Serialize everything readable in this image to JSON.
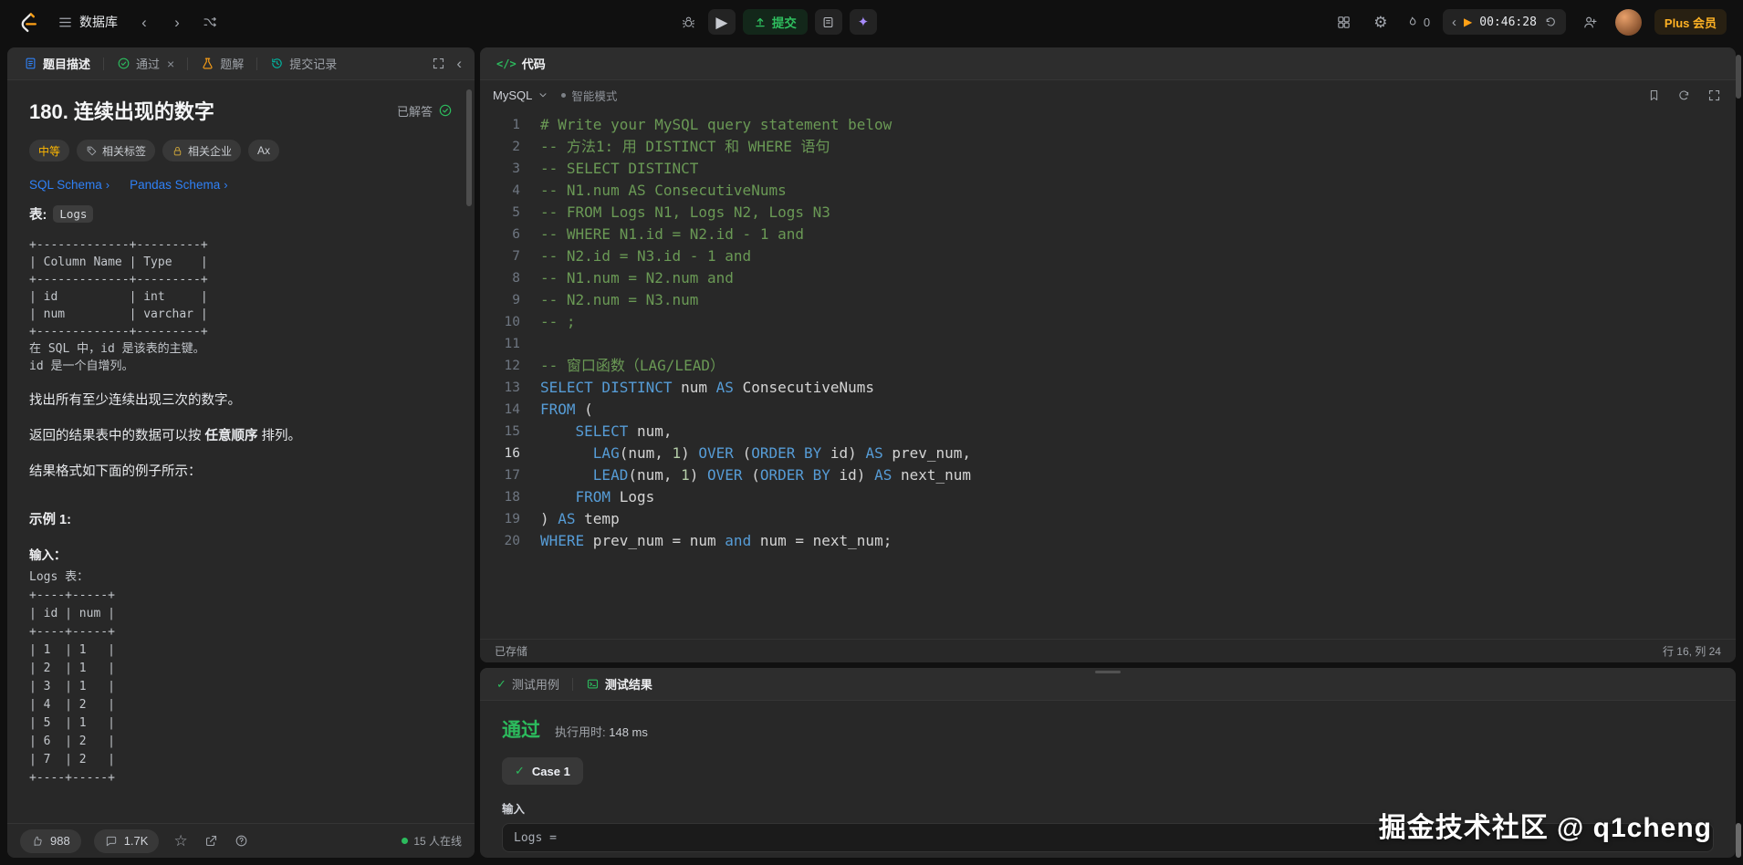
{
  "topbar": {
    "nav_label": "数据库",
    "submit_label": "提交",
    "streak_count": "0",
    "timer": "00:46:28",
    "plus_label": "Plus 会员"
  },
  "icons": {
    "chevron_left": "‹",
    "chevron_right": "›",
    "chevron_down": "∨",
    "play": "▶",
    "gear": "⚙",
    "star": "☆",
    "check": "✓",
    "close": "×",
    "sparkle": "✦",
    "code": "</>",
    "terminal_prompt": ">_"
  },
  "colors": {
    "accent_green": "#2cbb5d",
    "brand_orange": "#ffa116",
    "difficulty_medium": "#ffb800",
    "keyword_blue": "#569cd6",
    "comment_green": "#6a9955",
    "link_blue": "#2f81f7",
    "ai_purple": "#a78bfa"
  },
  "left_panel": {
    "tabs": {
      "description": "题目描述",
      "passed": "通过",
      "solutions": "题解",
      "submissions": "提交记录"
    },
    "title": "180. 连续出现的数字",
    "solved_label": "已解答",
    "badges": {
      "difficulty": "中等",
      "tags": "相关标签",
      "companies": "相关企业",
      "hint": "Ax"
    },
    "links": {
      "sql": "SQL Schema",
      "pandas": "Pandas Schema"
    },
    "table_label": "表:",
    "table_name": "Logs",
    "schema_pre": "+-------------+---------+\n| Column Name | Type    |\n+-------------+---------+\n| id          | int     |\n| num         | varchar |\n+-------------+---------+\n在 SQL 中，id 是该表的主键。\nid 是一个自增列。",
    "desc1": "找出所有至少连续出现三次的数字。",
    "desc2_pre": "返回的结果表中的数据可以按 ",
    "desc2_bold": "任意顺序",
    "desc2_post": " 排列。",
    "desc3": "结果格式如下面的例子所示：",
    "example_label": "示例 1:",
    "input_label": "输入：",
    "example_pre": "Logs 表：\n+----+-----+\n| id | num |\n+----+-----+\n| 1  | 1   |\n| 2  | 1   |\n| 3  | 1   |\n| 4  | 2   |\n| 5  | 1   |\n| 6  | 2   |\n| 7  | 2   |\n+----+-----+",
    "footer": {
      "likes": "988",
      "comments": "1.7K",
      "online": "15 人在线"
    }
  },
  "code_panel": {
    "tab": "代码",
    "language": "MySQL",
    "mode": "智能模式",
    "status_left": "已存储",
    "status_right": "行 16, 列 24",
    "active_line": 16,
    "lines": [
      [
        [
          "cm",
          "# Write your MySQL query statement below"
        ]
      ],
      [
        [
          "cm",
          "-- 方法1: 用 DISTINCT 和 WHERE 语句"
        ]
      ],
      [
        [
          "cm",
          "-- SELECT DISTINCT"
        ]
      ],
      [
        [
          "cm",
          "-- N1.num AS ConsecutiveNums"
        ]
      ],
      [
        [
          "cm",
          "-- FROM Logs N1, Logs N2, Logs N3"
        ]
      ],
      [
        [
          "cm",
          "-- WHERE N1.id = N2.id - 1 and"
        ]
      ],
      [
        [
          "cm",
          "-- N2.id = N3.id - 1 and"
        ]
      ],
      [
        [
          "cm",
          "-- N1.num = N2.num and"
        ]
      ],
      [
        [
          "cm",
          "-- N2.num = N3.num"
        ]
      ],
      [
        [
          "cm",
          "-- ;"
        ]
      ],
      [],
      [
        [
          "cm",
          "-- 窗口函数（LAG/LEAD）"
        ]
      ],
      [
        [
          "kw",
          "SELECT DISTINCT"
        ],
        [
          "tx",
          " num "
        ],
        [
          "kw",
          "AS"
        ],
        [
          "tx",
          " ConsecutiveNums"
        ]
      ],
      [
        [
          "kw",
          "FROM"
        ],
        [
          "tx",
          " ("
        ]
      ],
      [
        [
          "tx",
          "    "
        ],
        [
          "kw",
          "SELECT"
        ],
        [
          "tx",
          " num,"
        ]
      ],
      [
        [
          "tx",
          "      "
        ],
        [
          "kw",
          "LAG"
        ],
        [
          "tx",
          "(num, "
        ],
        [
          "nm",
          "1"
        ],
        [
          "tx",
          ") "
        ],
        [
          "kw",
          "OVER"
        ],
        [
          "tx",
          " ("
        ],
        [
          "kw",
          "ORDER BY"
        ],
        [
          "tx",
          " id) "
        ],
        [
          "kw",
          "AS"
        ],
        [
          "tx",
          " prev_num,"
        ]
      ],
      [
        [
          "tx",
          "      "
        ],
        [
          "kw",
          "LEAD"
        ],
        [
          "tx",
          "(num, "
        ],
        [
          "nm",
          "1"
        ],
        [
          "tx",
          ") "
        ],
        [
          "kw",
          "OVER"
        ],
        [
          "tx",
          " ("
        ],
        [
          "kw",
          "ORDER BY"
        ],
        [
          "tx",
          " id) "
        ],
        [
          "kw",
          "AS"
        ],
        [
          "tx",
          " next_num"
        ]
      ],
      [
        [
          "tx",
          "    "
        ],
        [
          "kw",
          "FROM"
        ],
        [
          "tx",
          " Logs"
        ]
      ],
      [
        [
          "tx",
          ") "
        ],
        [
          "kw",
          "AS"
        ],
        [
          "tx",
          " temp"
        ]
      ],
      [
        [
          "kw",
          "WHERE"
        ],
        [
          "tx",
          " prev_num = num "
        ],
        [
          "kw",
          "and"
        ],
        [
          "tx",
          " num = next_num;"
        ]
      ]
    ]
  },
  "test_panel": {
    "tab_cases": "测试用例",
    "tab_result": "测试结果",
    "verdict": "通过",
    "runtime_label": "执行用时:",
    "runtime_value": "148 ms",
    "case_label": "Case 1",
    "input_label": "输入",
    "input_value": "Logs ="
  },
  "watermark": "掘金技术社区 @ q1cheng"
}
